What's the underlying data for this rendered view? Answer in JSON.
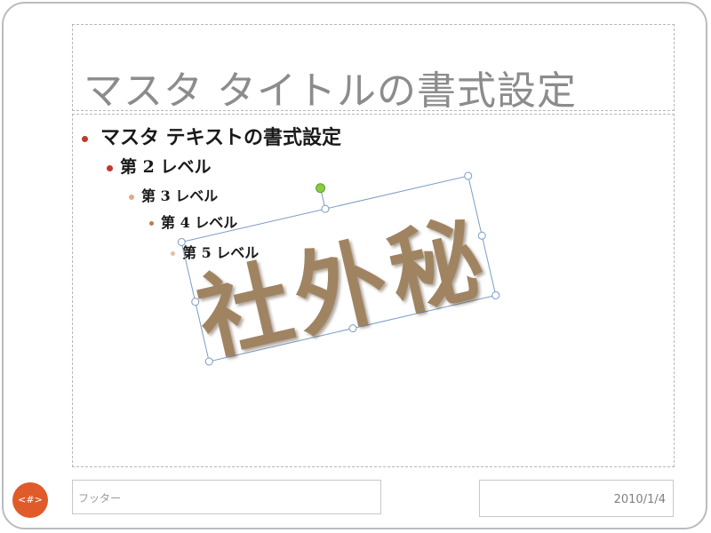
{
  "title": "マスタ タイトルの書式設定",
  "body": {
    "level1": "マスタ テキストの書式設定",
    "level2": "第 2 レベル",
    "level3": "第 3 レベル",
    "level4": "第 4 レベル",
    "level5": "第 5 レベル"
  },
  "stamp": {
    "text": "社外秘",
    "color": "#a08462"
  },
  "footer": "フッター",
  "date": "2010/1/4",
  "slide_number": "<#>",
  "colors": {
    "bullet_accent": "#c0392b",
    "slide_number_bg": "#e05a2a",
    "selection": "#7b9cc2",
    "rotation_handle": "#88cc44"
  }
}
